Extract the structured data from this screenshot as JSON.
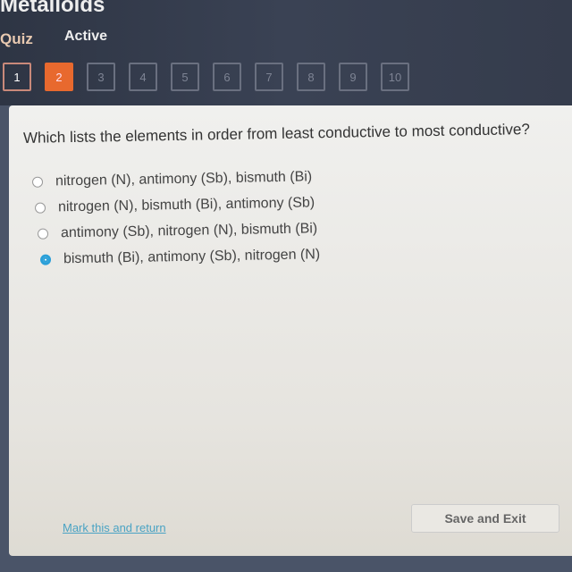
{
  "header": {
    "title": "Metalloids",
    "type": "Quiz",
    "status": "Active"
  },
  "questions": [
    {
      "label": "1",
      "state": "answered"
    },
    {
      "label": "2",
      "state": "current"
    },
    {
      "label": "3"
    },
    {
      "label": "4"
    },
    {
      "label": "5"
    },
    {
      "label": "6"
    },
    {
      "label": "7"
    },
    {
      "label": "8"
    },
    {
      "label": "9"
    },
    {
      "label": "10"
    }
  ],
  "question": {
    "text": "Which lists the elements in order from least conductive to most conductive?",
    "options": [
      {
        "text": "nitrogen (N), antimony (Sb), bismuth (Bi)",
        "selected": false
      },
      {
        "text": "nitrogen (N), bismuth (Bi), antimony (Sb)",
        "selected": false
      },
      {
        "text": "antimony (Sb), nitrogen (N), bismuth (Bi)",
        "selected": false
      },
      {
        "text": "bismuth (Bi), antimony (Sb), nitrogen (N)",
        "selected": true
      }
    ]
  },
  "footer": {
    "mark_link": "Mark this and return",
    "save_label": "Save and Exit"
  },
  "colors": {
    "accent": "#e8692e",
    "radio": "#2a9fd8",
    "link": "#4aa3c4"
  }
}
